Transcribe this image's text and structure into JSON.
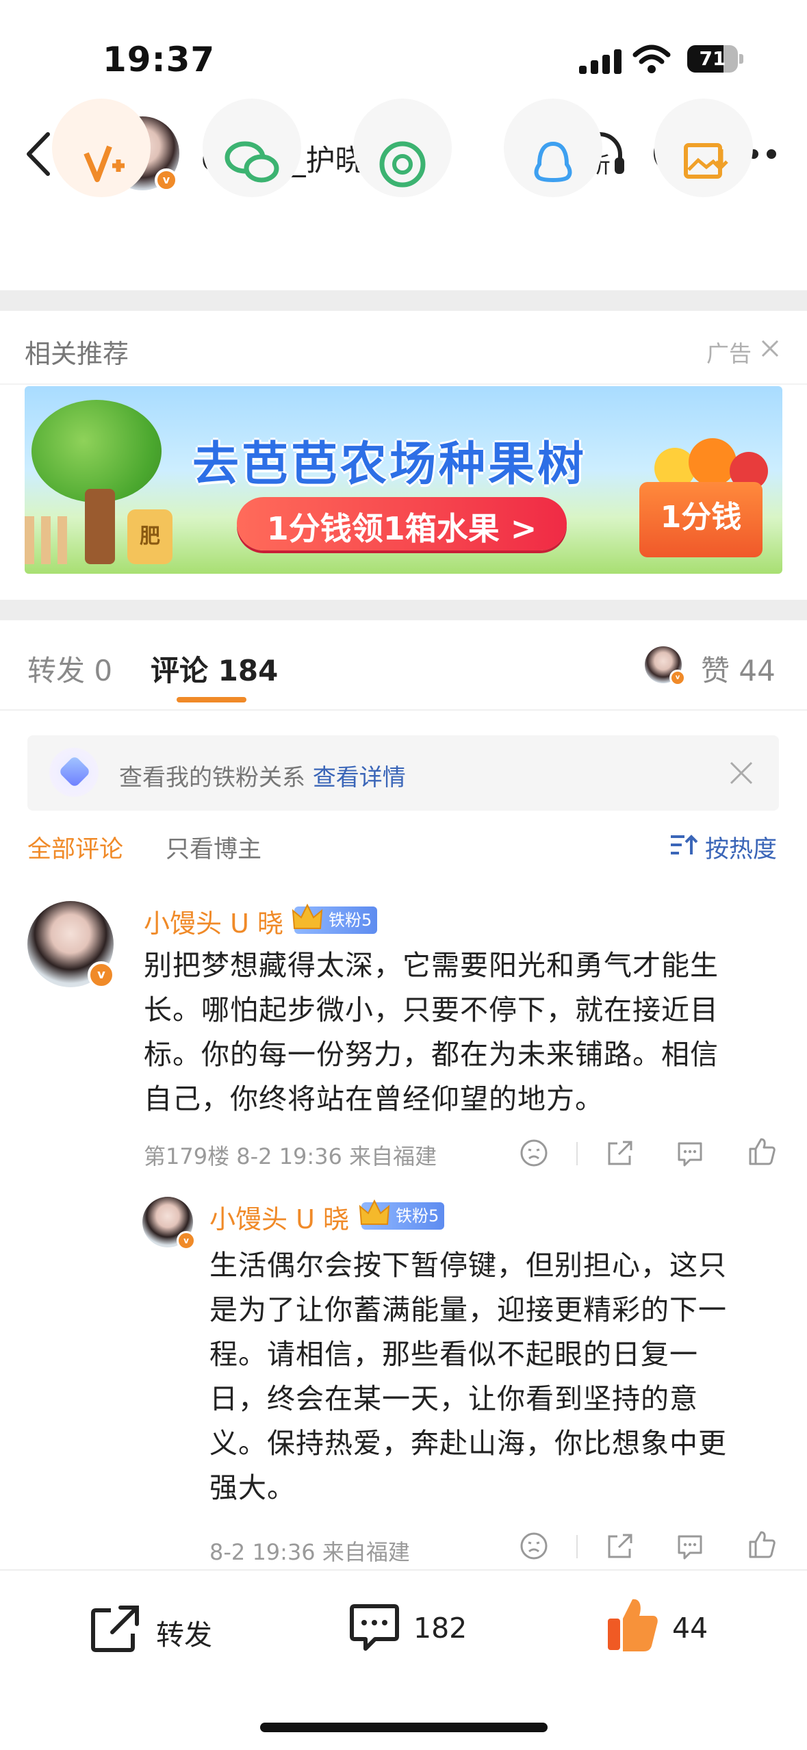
{
  "status_bar": {
    "time": "19:37",
    "battery": "71"
  },
  "nav": {
    "title": "Guard_护晓计划",
    "listen_label": "听"
  },
  "share_row": {
    "icons": [
      "vplus-icon",
      "wechat-icon",
      "moments-icon",
      "qq-icon",
      "save-image-icon"
    ]
  },
  "related": {
    "title": "相关推荐",
    "ad_label": "广告"
  },
  "banner": {
    "title": "去芭芭农场种果树",
    "cta": "1分钱领1箱水果 >",
    "box_label": "1分钱",
    "bag_label": "肥"
  },
  "tabs": {
    "repost": "转发 0",
    "comment": "评论 184",
    "like": "赞 44"
  },
  "fan_notice": {
    "text": "查看我的铁粉关系",
    "link": "查看详情"
  },
  "filters": {
    "all": "全部评论",
    "blogger_only": "只看博主",
    "sort": "按热度"
  },
  "comments": [
    {
      "name": "小馒头 U 晓",
      "badge": "铁粉5",
      "text_lines": [
        "别把梦想藏得太深，它需要阳光和勇气才能生",
        "长。哪怕起步微小，只要不停下，就在接近目",
        "标。你的每一份努力，都在为未来铺路。相信",
        "自己，你终将站在曾经仰望的地方。"
      ],
      "meta": "第179楼 8-2 19:36 来自福建"
    },
    {
      "name": "小馒头 U 晓",
      "badge": "铁粉5",
      "text_lines": [
        "生活偶尔会按下暂停键，但别担心，这只",
        "是为了让你蓄满能量，迎接更精彩的下一",
        "程。请相信，那些看似不起眼的日复一",
        "日，终会在某一天，让你看到坚持的意",
        "义。保持热爱，奔赴山海，你比想象中更",
        "强大。"
      ],
      "meta": "8-2 19:36 来自福建"
    }
  ],
  "bottom_bar": {
    "repost": "转发",
    "comments": "182",
    "likes": "44"
  },
  "colors": {
    "accent": "#f08a28",
    "link": "#3b66b8"
  }
}
